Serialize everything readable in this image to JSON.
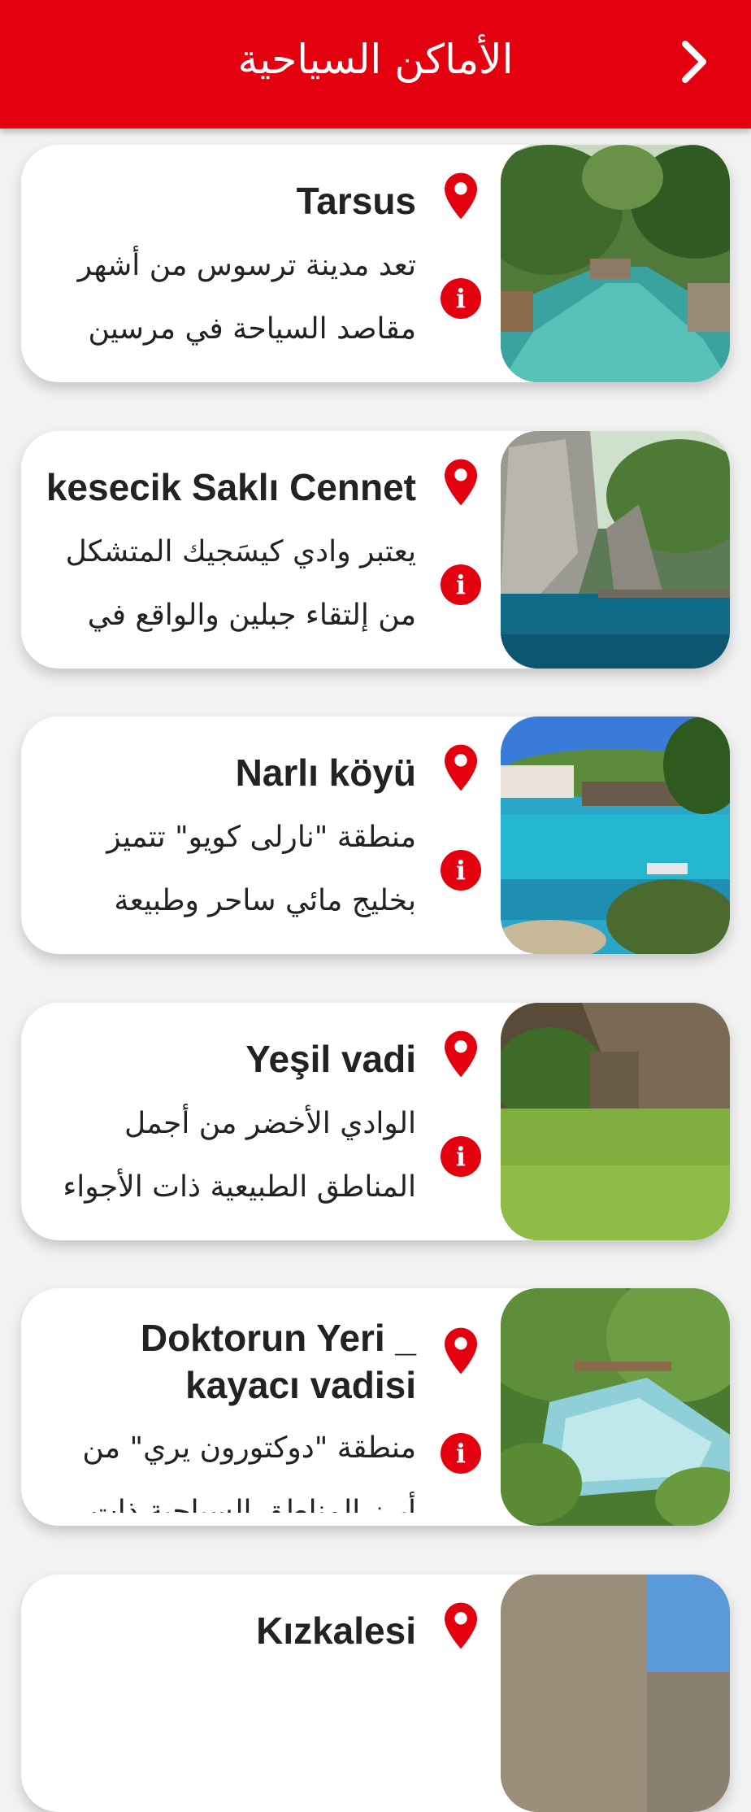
{
  "header": {
    "title": "الأماكن السياحية",
    "back_icon": "chevron-right-icon"
  },
  "colors": {
    "accent": "#e3000f",
    "card": "#ffffff",
    "background": "#f2f2f2"
  },
  "places": [
    {
      "title": "Tarsus",
      "description_line1": "تعد مدينة ترسوس من أشهر",
      "description_line2": "مقاصد السياحة في مرسين"
    },
    {
      "title": "kesecik Saklı Cennet",
      "description_line1": "يعتبر وادي كيسَجيك المتشكل",
      "description_line2": "من إلتقاء جبلين والواقع في"
    },
    {
      "title": "Narlı köyü",
      "description_line1": "منطقة \"نارلى كويو\" تتميز",
      "description_line2": "بخليج مائي ساحر وطبيعة"
    },
    {
      "title": "Yeşil vadi",
      "description_line1": "الوادي الأخضر من أجمل",
      "description_line2": "المناطق الطبيعية ذات الأجواء"
    },
    {
      "title_line1": "Doktorun Yeri _",
      "title_line2": "kayacı vadisi",
      "description_line1": "منطقة \"دوكتورون يري\" من",
      "description_line2": "أبرز المناطق السياحية ذات"
    },
    {
      "title": "Kızkalesi"
    }
  ]
}
